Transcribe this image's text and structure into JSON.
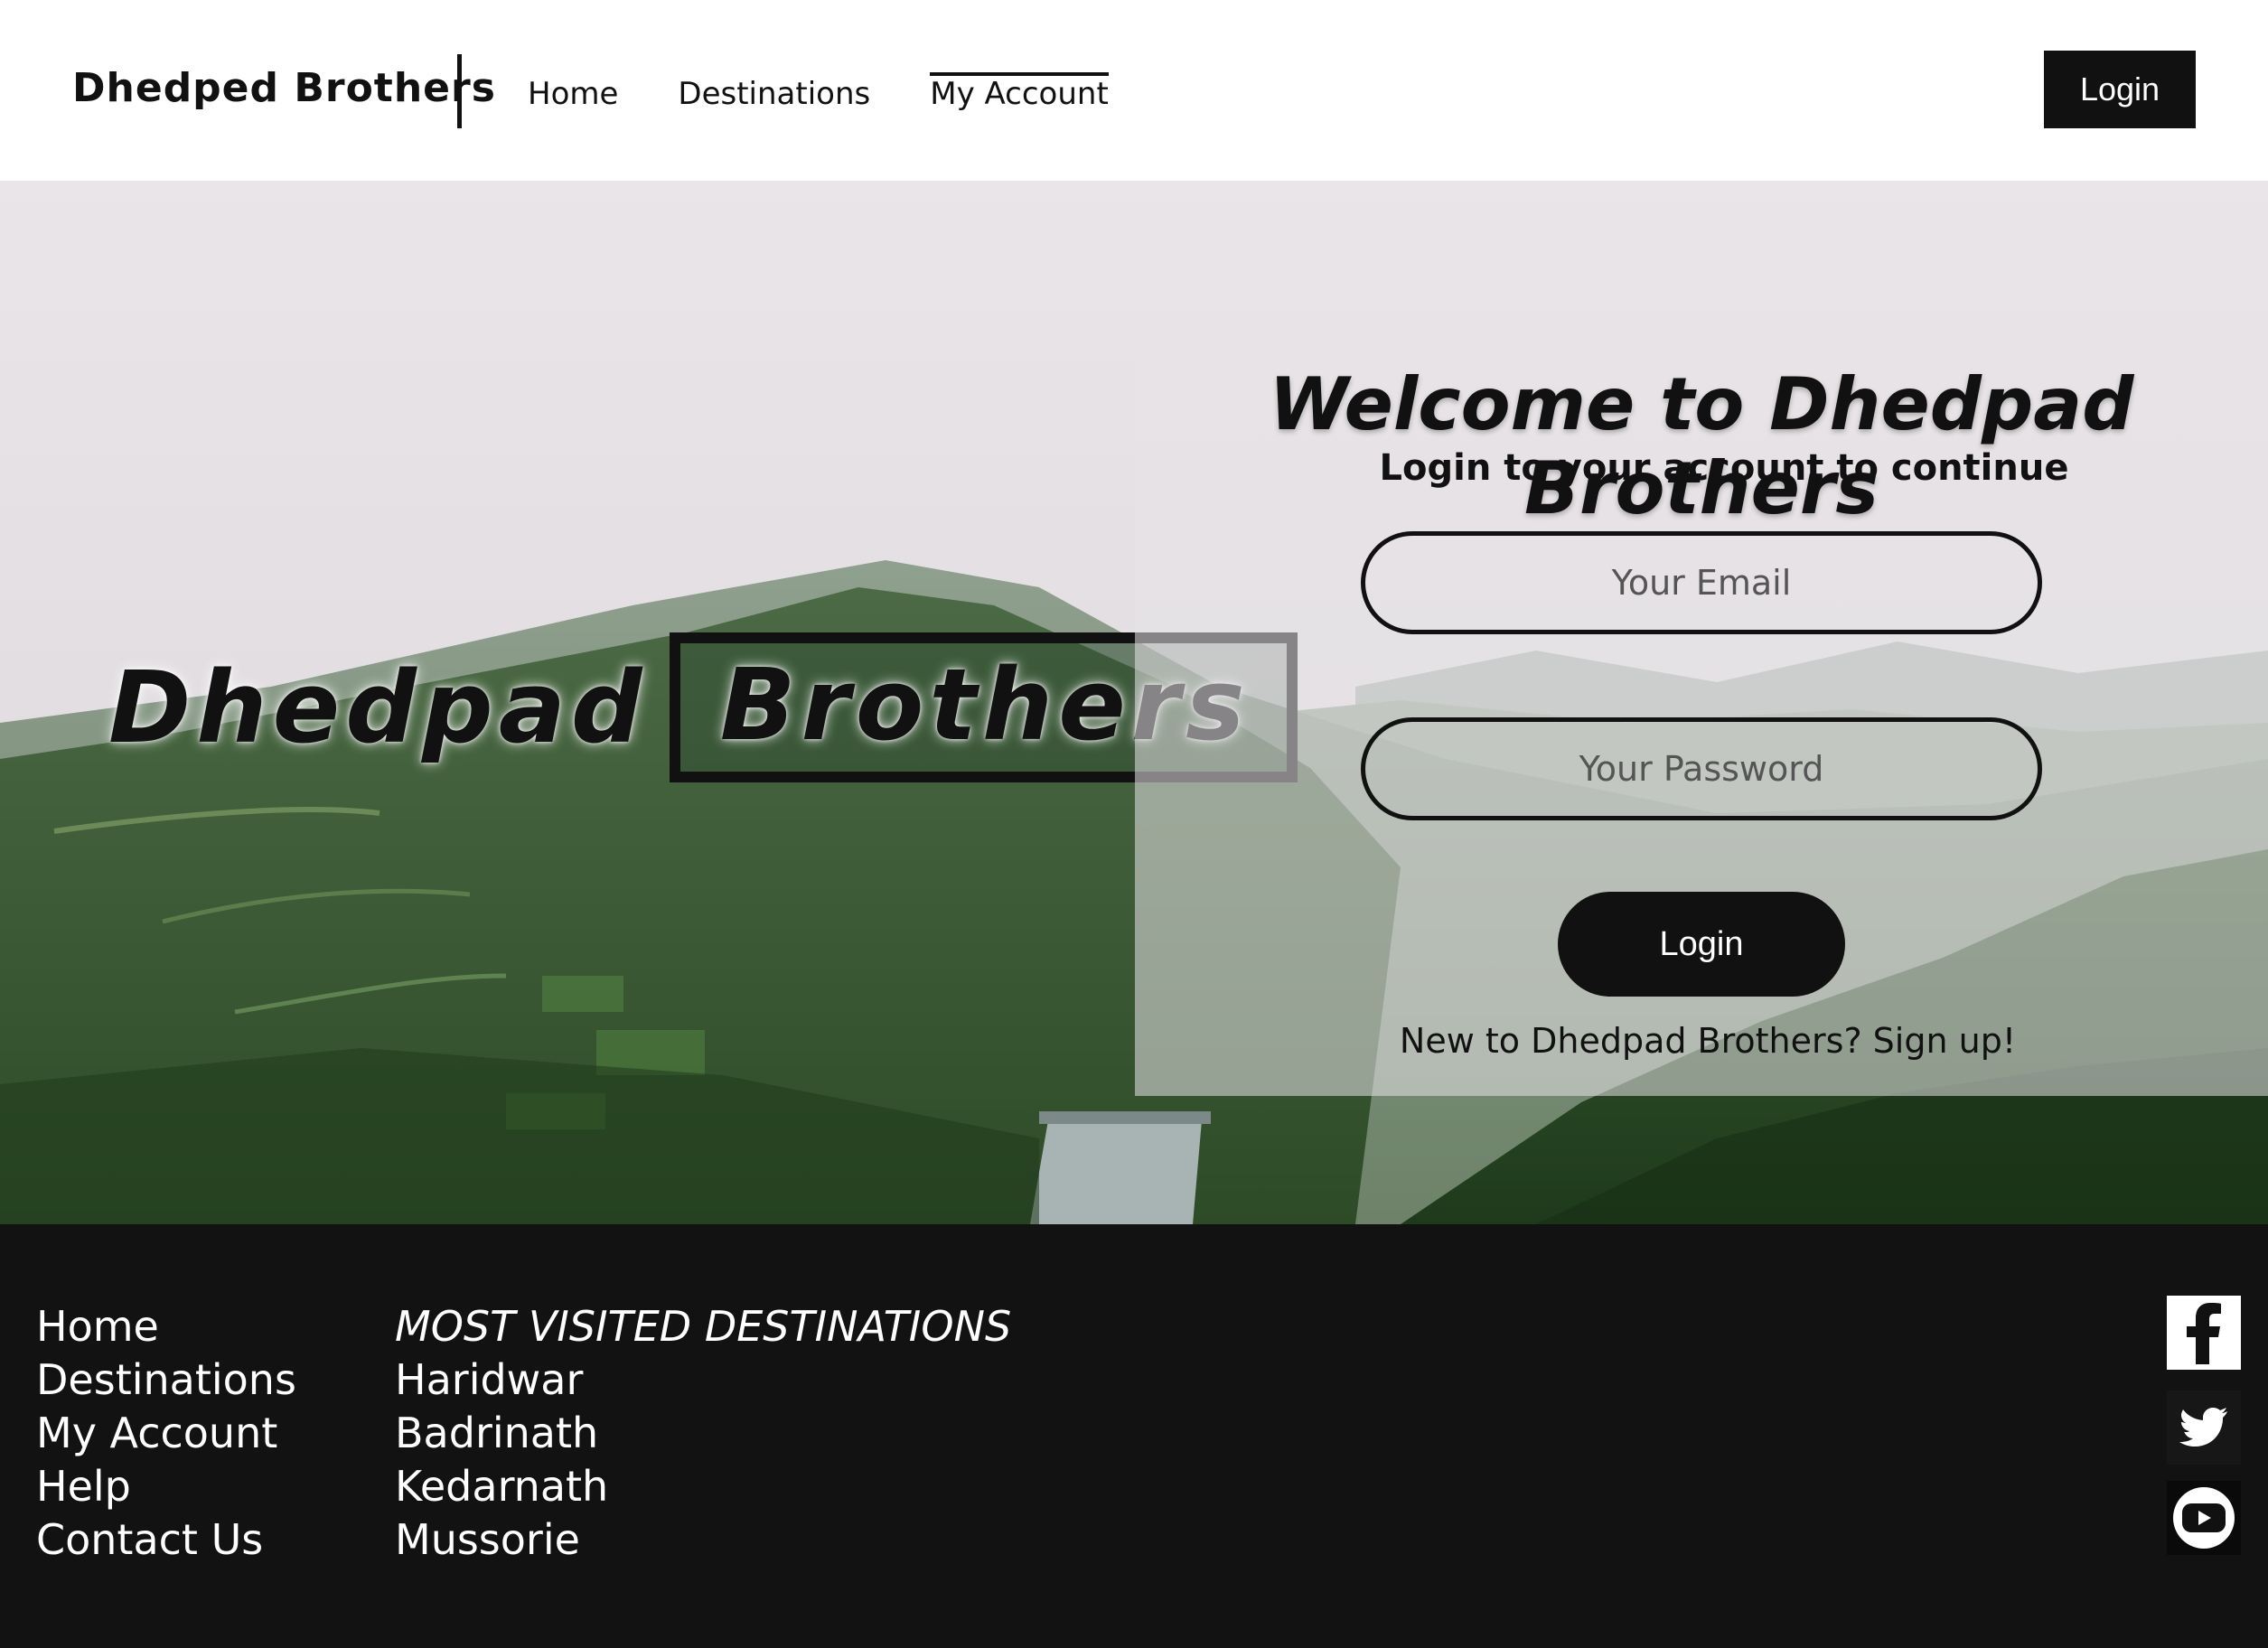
{
  "header": {
    "brand": "Dhedped Brothers",
    "nav": [
      {
        "label": "Home",
        "active": false
      },
      {
        "label": "Destinations",
        "active": false
      },
      {
        "label": "My Account",
        "active": true
      }
    ],
    "login_label": "Login"
  },
  "hero": {
    "logo_word1": "Dhedpad",
    "logo_word2": "Brothers"
  },
  "login_panel": {
    "title": "Welcome to Dhedpad Brothers",
    "subtitle": "Login to your account to continue",
    "email_placeholder": "Your Email",
    "password_placeholder": "Your Password",
    "submit_label": "Login",
    "signup_text": "New to Dhedpad Brothers? Sign up!"
  },
  "footer": {
    "links": [
      "Home",
      "Destinations",
      "My Account",
      "Help",
      "Contact Us"
    ],
    "destinations_heading": "MOST VISITED DESTINATIONS",
    "destinations": [
      "Haridwar",
      "Badrinath",
      "Kedarnath",
      "Mussorie"
    ],
    "social_icons": [
      "facebook-icon",
      "twitter-icon",
      "youtube-icon"
    ]
  },
  "colors": {
    "primary": "#111111",
    "footer_bg": "#121212",
    "text_light": "#ffffff"
  }
}
